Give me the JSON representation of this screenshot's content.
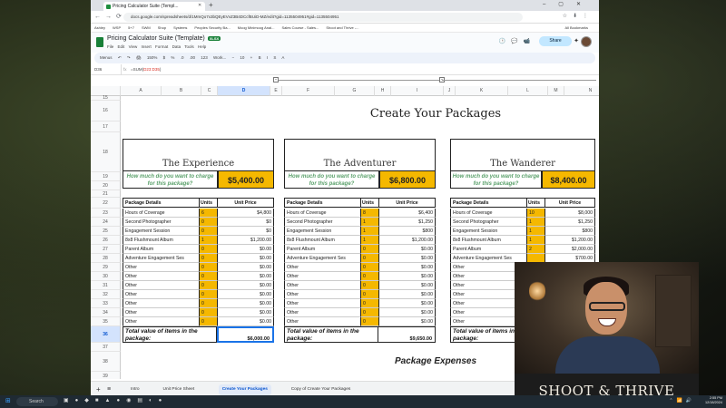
{
  "browser": {
    "tab_title": "Pricing Calculator Suite (Templ...",
    "url": "docs.google.com/spreadsheets/d/1MmQo7x3bQEyEVvZ3B4DCcfBUiD-MZ/edit?gid=1135504951#gid=1135504951",
    "bookmarks": [
      "Ashley",
      "WSP",
      "5+7",
      "SWM",
      "Shop",
      "Systems",
      "Peoples Security Ba...",
      "Moog Minimoog Anal...",
      "Sales Course - Sales...",
      "Shoot and Thrive -..."
    ],
    "all_bookmarks": "All Bookmarks"
  },
  "sheets": {
    "title": "Pricing Calculator Suite (Template)",
    "badge": "XLSX",
    "menu": [
      "File",
      "Edit",
      "View",
      "Insert",
      "Format",
      "Data",
      "Tools",
      "Help"
    ],
    "share_label": "Share",
    "toolbar_items": [
      "Menus",
      "↶",
      "↷",
      "🖨",
      "150%",
      "$",
      "%",
      ".0",
      ".00",
      "123",
      "Work...",
      "−",
      "10",
      "+",
      "B",
      "I",
      "S",
      "A"
    ],
    "cell_ref": "D36",
    "formula_prefix": "=SUM(",
    "formula_range": "D23:D35",
    "formula_suffix": ")",
    "columns": [
      "A",
      "B",
      "C",
      "D",
      "E",
      "F",
      "G",
      "H",
      "I",
      "J",
      "K",
      "L",
      "M",
      "N"
    ],
    "rows": [
      "15",
      "16",
      "17",
      "18",
      "19",
      "20",
      "21",
      "22",
      "23",
      "24",
      "25",
      "26",
      "27",
      "28",
      "29",
      "30",
      "31",
      "32",
      "33",
      "34",
      "35",
      "36",
      "37",
      "38",
      "39"
    ],
    "selected_col": "D",
    "selected_row": "36"
  },
  "main_title": "Create Your Packages",
  "ask_text": "How much do you want to charge for this package?",
  "headers": {
    "details": "Package Details",
    "units": "Units",
    "price": "Unit Price"
  },
  "total_label": "Total value of items in the package:",
  "expenses_title": "Package Expenses",
  "packages": [
    {
      "name": "The Experience",
      "charge": "$5,400.00",
      "total": "$6,000.00",
      "items": [
        {
          "detail": "Hours of Coverage",
          "units": "6",
          "price": "$4,800"
        },
        {
          "detail": "Second Photographer",
          "units": "0",
          "price": "$0"
        },
        {
          "detail": "Engagement Session",
          "units": "0",
          "price": "$0"
        },
        {
          "detail": "8x8 Flushmount Album",
          "units": "1",
          "price": "$1,200.00"
        },
        {
          "detail": "Parent Album",
          "units": "0",
          "price": "$0.00"
        },
        {
          "detail": "Adventure Engagement Ses",
          "units": "0",
          "price": "$0.00"
        },
        {
          "detail": "Other",
          "units": "0",
          "price": "$0.00"
        },
        {
          "detail": "Other",
          "units": "0",
          "price": "$0.00"
        },
        {
          "detail": "Other",
          "units": "0",
          "price": "$0.00"
        },
        {
          "detail": "Other",
          "units": "0",
          "price": "$0.00"
        },
        {
          "detail": "Other",
          "units": "0",
          "price": "$0.00"
        },
        {
          "detail": "Other",
          "units": "0",
          "price": "$0.00"
        },
        {
          "detail": "Other",
          "units": "0",
          "price": "$0.00"
        }
      ]
    },
    {
      "name": "The Adventurer",
      "charge": "$6,800.00",
      "total": "$9,650.00",
      "items": [
        {
          "detail": "Hours of Coverage",
          "units": "8",
          "price": "$6,400"
        },
        {
          "detail": "Second Photographer",
          "units": "1",
          "price": "$1,250"
        },
        {
          "detail": "Engagement Session",
          "units": "1",
          "price": "$800"
        },
        {
          "detail": "8x8 Flushmount Album",
          "units": "1",
          "price": "$1,200.00"
        },
        {
          "detail": "Parent Album",
          "units": "0",
          "price": "$0.00"
        },
        {
          "detail": "Adventure Engagement Ses",
          "units": "0",
          "price": "$0.00"
        },
        {
          "detail": "Other",
          "units": "0",
          "price": "$0.00"
        },
        {
          "detail": "Other",
          "units": "0",
          "price": "$0.00"
        },
        {
          "detail": "Other",
          "units": "0",
          "price": "$0.00"
        },
        {
          "detail": "Other",
          "units": "0",
          "price": "$0.00"
        },
        {
          "detail": "Other",
          "units": "0",
          "price": "$0.00"
        },
        {
          "detail": "Other",
          "units": "0",
          "price": "$0.00"
        },
        {
          "detail": "Other",
          "units": "0",
          "price": "$0.00"
        }
      ]
    },
    {
      "name": "The Wanderer",
      "charge": "$8,400.00",
      "total": "",
      "items": [
        {
          "detail": "Hours of Coverage",
          "units": "10",
          "price": "$8,000"
        },
        {
          "detail": "Second Photographer",
          "units": "1",
          "price": "$1,250"
        },
        {
          "detail": "Engagement Session",
          "units": "1",
          "price": "$800"
        },
        {
          "detail": "8x8 Flushmount Album",
          "units": "1",
          "price": "$1,200.00"
        },
        {
          "detail": "Parent Album",
          "units": "2",
          "price": "$2,000.00"
        },
        {
          "detail": "Adventure Engagement Ses",
          "units": "",
          "price": "$700.00"
        },
        {
          "detail": "Other",
          "units": "",
          "price": ""
        },
        {
          "detail": "Other",
          "units": "",
          "price": ""
        },
        {
          "detail": "Other",
          "units": "",
          "price": ""
        },
        {
          "detail": "Other",
          "units": "",
          "price": ""
        },
        {
          "detail": "Other",
          "units": "",
          "price": ""
        },
        {
          "detail": "Other",
          "units": "",
          "price": ""
        },
        {
          "detail": "Other",
          "units": "",
          "price": ""
        }
      ]
    }
  ],
  "sheet_tabs": [
    "Intro",
    "Unit Price Sheet",
    "Create Your Packages",
    "Copy of Create Your Packages"
  ],
  "active_sheet_tab": "Create Your Packages",
  "webcam_brand": "SHOOT & THRIVE",
  "taskbar": {
    "search_placeholder": "Search",
    "time": "2:55 PM",
    "date": "12/18/2024"
  },
  "colors": {
    "accent_yellow": "#f5b800",
    "ask_green": "#5aa06a",
    "sheets_green": "#188038",
    "selection_blue": "#1a73e8"
  }
}
